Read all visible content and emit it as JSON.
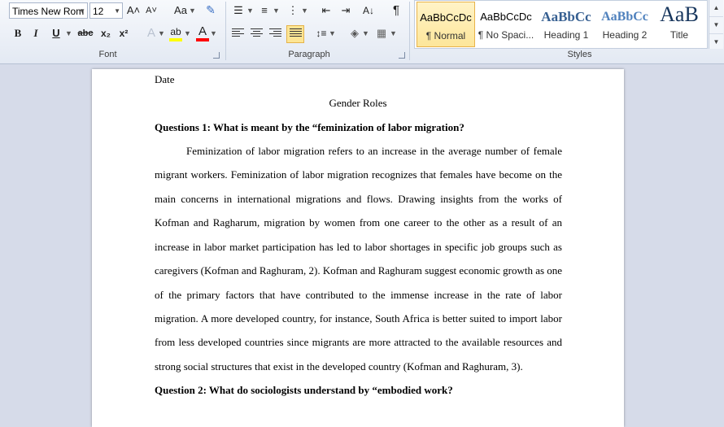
{
  "ribbon": {
    "font": {
      "label": "Font",
      "font_name": "Times New Rom",
      "font_size": "12",
      "grow_icon": "A˄",
      "shrink_icon": "A˅",
      "case_icon": "Aa",
      "bold": "B",
      "italic": "I",
      "underline": "U",
      "strike": "abc",
      "subscript": "x₂",
      "superscript": "x²"
    },
    "paragraph": {
      "label": "Paragraph",
      "pilcrow": "¶"
    },
    "styles": {
      "label": "Styles",
      "items": [
        {
          "sample": "AaBbCcDc",
          "name": "¶ Normal"
        },
        {
          "sample": "AaBbCcDc",
          "name": "¶ No Spaci..."
        },
        {
          "sample": "AaBbCc",
          "name": "Heading 1"
        },
        {
          "sample": "AaBbCc",
          "name": "Heading 2"
        },
        {
          "sample": "AaB",
          "name": "Title"
        }
      ]
    },
    "colors": {
      "highlight": "#ffff00",
      "font_color": "#ff0000",
      "accent": "#365f91"
    }
  },
  "document": {
    "date": "Date",
    "title": "Gender Roles",
    "q1": "Questions 1: What is meant by the “feminization of labor migration?",
    "para_lines": [
      "Feminization of labor migration refers to an increase in the average number of female",
      "migrant workers. Feminization of labor migration recognizes that females have become on the",
      "main concerns in international migrations and flows.  Drawing insights from the works of",
      "Kofman and Ragharum, migration by women from one career to the other as a result of an",
      "increase in labor market participation has led to labor shortages in specific job groups such as",
      "caregivers (Kofman and Raghuram, 2). Kofman and Raghuram suggest economic growth as one",
      "of the primary factors that have contributed to the immense increase in the rate of labor",
      "migration. A more developed country, for instance, South Africa is better suited to import labor",
      "from less developed countries since migrants are more attracted to the available resources and",
      "strong social structures that exist in the developed country (Kofman and Raghuram, 3)."
    ],
    "q2": "Question 2: What do sociologists understand by “embodied work?"
  }
}
